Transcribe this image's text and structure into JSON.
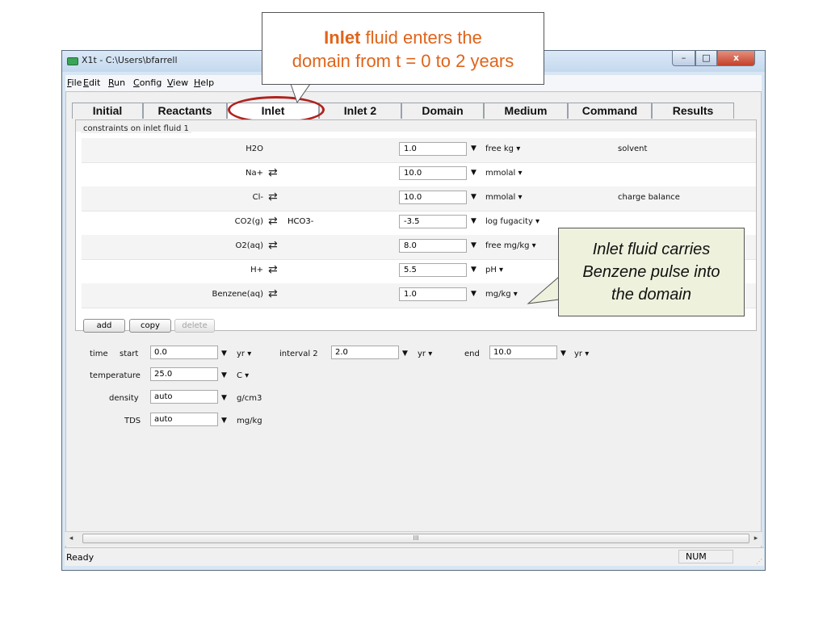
{
  "window": {
    "title": "X1t - C:\\Users\\bfarrell",
    "minimize": "–",
    "maximize": "□",
    "close": "x"
  },
  "menu": [
    "File",
    "Edit",
    "Run",
    "Config",
    "View",
    "Help"
  ],
  "tabs": [
    {
      "label": "Initial",
      "active": false
    },
    {
      "label": "Reactants",
      "active": false
    },
    {
      "label": "Inlet",
      "active": true
    },
    {
      "label": "Inlet 2",
      "active": false
    },
    {
      "label": "Domain",
      "active": false
    },
    {
      "label": "Medium",
      "active": false
    },
    {
      "label": "Command",
      "active": false
    },
    {
      "label": "Results",
      "active": false
    }
  ],
  "constraints": {
    "legend": "constraints on inlet fluid 1",
    "rows": [
      {
        "species": "H2O",
        "swap": "",
        "alt": "",
        "value": "1.0",
        "unit": "free kg ▾",
        "note": "solvent"
      },
      {
        "species": "Na+",
        "swap": "⇄",
        "alt": "",
        "value": "10.0",
        "unit": "mmolal ▾",
        "note": ""
      },
      {
        "species": "Cl-",
        "swap": "⇄",
        "alt": "",
        "value": "10.0",
        "unit": "mmolal ▾",
        "note": "charge balance"
      },
      {
        "species": "CO2(g)",
        "swap": "⇄",
        "alt": "HCO3-",
        "value": "-3.5",
        "unit": "log fugacity ▾",
        "note": ""
      },
      {
        "species": "O2(aq)",
        "swap": "⇄",
        "alt": "",
        "value": "8.0",
        "unit": "free mg/kg ▾",
        "note": ""
      },
      {
        "species": "H+",
        "swap": "⇄",
        "alt": "",
        "value": "5.5",
        "unit": "pH ▾",
        "note": ""
      },
      {
        "species": "Benzene(aq)",
        "swap": "⇄",
        "alt": "",
        "value": "1.0",
        "unit": "mg/kg ▾",
        "note": ""
      }
    ],
    "buttons": {
      "add": "add",
      "copy": "copy",
      "delete": "delete"
    }
  },
  "time": {
    "label_time": "time",
    "label_start": "start",
    "start": "0.0",
    "start_unit": "yr ▾",
    "label_interval": "interval 2",
    "interval": "2.0",
    "interval_unit": "yr ▾",
    "label_end": "end",
    "end": "10.0",
    "end_unit": "yr ▾"
  },
  "temperature": {
    "label": "temperature",
    "value": "25.0",
    "unit": "C ▾"
  },
  "density": {
    "label": "density",
    "value": "auto",
    "unit": "g/cm3"
  },
  "tds": {
    "label": "TDS",
    "value": "auto",
    "unit": "mg/kg"
  },
  "status": {
    "text": "Ready",
    "num": "NUM"
  },
  "scroll": {
    "left": "◂",
    "right": "▸",
    "grip": "III"
  },
  "callouts": {
    "top_bold": "Inlet",
    "top_rest": " fluid enters the",
    "top_line2": "domain from t = 0 to 2 years",
    "right_line1": "Inlet fluid carries",
    "right_line2": "Benzene pulse into",
    "right_line3": "the domain"
  },
  "colors": {
    "callout_text": "#e0641a",
    "highlight": "#b0221f",
    "callout_right_bg": "#eef1dc"
  }
}
